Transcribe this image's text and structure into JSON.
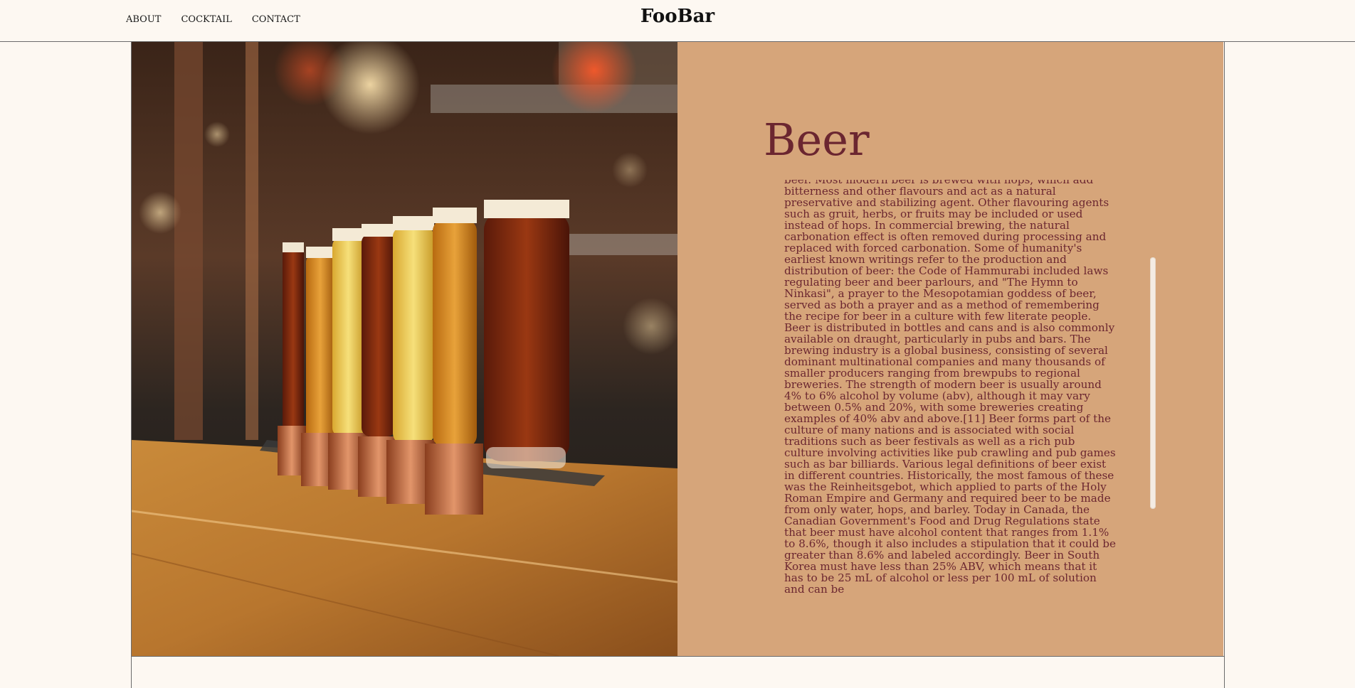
{
  "header": {
    "brand": "FooBar",
    "nav": [
      {
        "label": "ABOUT"
      },
      {
        "label": "COCKTAIL"
      },
      {
        "label": "CONTACT"
      }
    ]
  },
  "hero": {
    "image_alt": "Row of beer glasses on a bar counter",
    "title": "Beer",
    "body": "beer. Most modern beer is brewed with hops, which add bitterness and other flavours and act as a natural preservative and stabilizing agent. Other flavouring agents such as gruit, herbs, or fruits may be included or used instead of hops. In commercial brewing, the natural carbonation effect is often removed during processing and replaced with forced carbonation. Some of humanity's earliest known writings refer to the production and distribution of beer: the Code of Hammurabi included laws regulating beer and beer parlours, and \"The Hymn to Ninkasi\", a prayer to the Mesopotamian goddess of beer, served as both a prayer and as a method of remembering the recipe for beer in a culture with few literate people. Beer is distributed in bottles and cans and is also commonly available on draught, particularly in pubs and bars. The brewing industry is a global business, consisting of several dominant multinational companies and many thousands of smaller producers ranging from brewpubs to regional breweries. The strength of modern beer is usually around 4% to 6% alcohol by volume (abv), although it may vary between 0.5% and 20%, with some breweries creating examples of 40% abv and above.[11] Beer forms part of the culture of many nations and is associated with social traditions such as beer festivals as well as a rich pub culture involving activities like pub crawling and pub games such as bar billiards. Various legal definitions of beer exist in different countries. Historically, the most famous of these was the Reinheitsgebot, which applied to parts of the Holy Roman Empire and Germany and required beer to be made from only water, hops, and barley. Today in Canada, the Canadian Government's Food and Drug Regulations state that beer must have alcohol content that ranges from 1.1% to 8.6%, though it also includes a stipulation that it could be greater than 8.6% and labeled accordingly. Beer in South Korea must have less than 25% ABV, which means that it has to be 25 mL of alcohol or less per 100 mL of solution and can be"
  },
  "colors": {
    "background": "#fdf8f2",
    "panel": "#d6a57a",
    "heading": "#6b2630"
  }
}
